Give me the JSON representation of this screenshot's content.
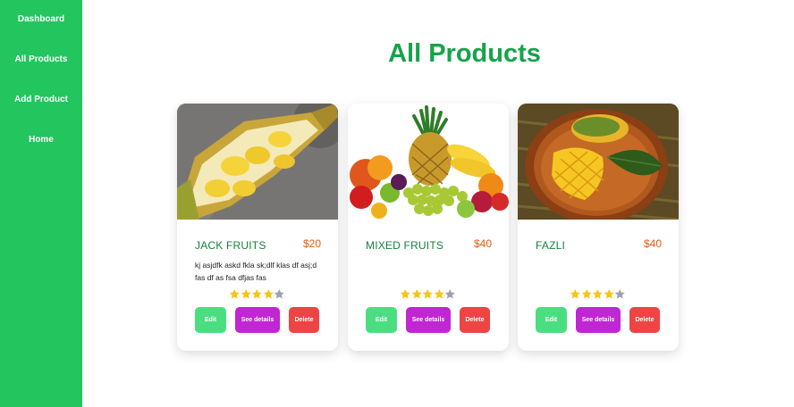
{
  "sidebar": {
    "items": [
      {
        "label": "Dashboard"
      },
      {
        "label": "All Products"
      },
      {
        "label": "Add Product"
      },
      {
        "label": "Home"
      }
    ]
  },
  "page": {
    "title": "All Products"
  },
  "products": [
    {
      "name": "JACK FRUITS",
      "price": "$20",
      "description": "kj asjdfk askd fkla sk;dlf klas df asj;d fas df as fsa dfjas fas",
      "rating": 4,
      "rating_max": 5,
      "image": "jackfruit",
      "buttons": {
        "edit": "Edit",
        "details": "See details",
        "delete": "Delete"
      }
    },
    {
      "name": "MIXED FRUITS",
      "price": "$40",
      "description": "",
      "rating": 4,
      "rating_max": 5,
      "image": "mixed-fruits",
      "buttons": {
        "edit": "Edit",
        "details": "See details",
        "delete": "Delete"
      }
    },
    {
      "name": "FAZLI",
      "price": "$40",
      "description": "",
      "rating": 4,
      "rating_max": 5,
      "image": "mango",
      "buttons": {
        "edit": "Edit",
        "details": "See details",
        "delete": "Delete"
      }
    }
  ],
  "colors": {
    "sidebar": "#22c55e",
    "title": "#16a34a",
    "price": "#ea580c",
    "edit": "#4ade80",
    "details": "#c026d3",
    "delete": "#ef4444",
    "star_filled": "#f5c518",
    "star_empty": "#9ca3af"
  }
}
